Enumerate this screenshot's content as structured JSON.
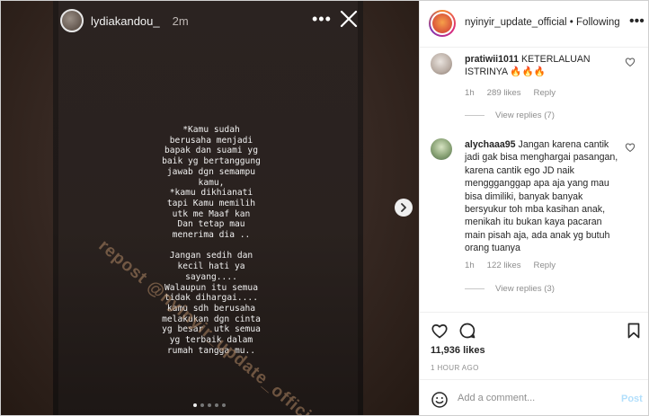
{
  "story": {
    "username": "lydiakandou_",
    "time": "2m",
    "more_label": "•••",
    "text": "*Kamu sudah\nberusaha menjadi\nbapak dan suami yg\nbaik yg bertanggung\njawab dgn semampu\nkamu,\n*kamu dikhianati\ntapi Kamu memilih\nutk me Maaf kan\nDan tetap mau\nmenerima dia ..\n\nJangan sedih dan\nkecil hati ya\nsayang....\nWalaupun itu semua\ntidak dihargai....\nkamu sdh berusaha\nmelakukan dgn cinta\nyg besar  utk semua\nyg terbaik dalam\nrumah tangga mu..",
    "watermark": "repost @nyinyir_update_official",
    "page_count": 5,
    "active_page": 1
  },
  "post": {
    "account": "nyinyir_update_official",
    "separator": "•",
    "follow_status": "Following"
  },
  "comments": [
    {
      "user": "pratiwii1011",
      "text": "KETERLALUAN ISTRINYA 🔥🔥🔥",
      "age": "1h",
      "likes": "289 likes",
      "reply": "Reply",
      "view_replies": "View replies (7)"
    },
    {
      "user": "alychaaa95",
      "text": "Jangan karena cantik jadi gak bisa menghargai pasangan, karena cantik ego JD naik menggganggap apa aja yang mau bisa dimiliki, banyak banyak bersyukur toh mba kasihan anak, menikah itu bukan kaya pacaran main pisah aja, ada anak yg butuh orang tuanya",
      "age": "1h",
      "likes": "122 likes",
      "reply": "Reply",
      "view_replies": "View replies (3)"
    }
  ],
  "stats": {
    "likes": "11,936 likes",
    "posted": "1 HOUR AGO"
  },
  "composer": {
    "placeholder": "Add a comment...",
    "post_label": "Post"
  },
  "colors": {
    "link_blue": "#b2dffc",
    "muted": "#8e8e8e",
    "text": "#262626"
  }
}
